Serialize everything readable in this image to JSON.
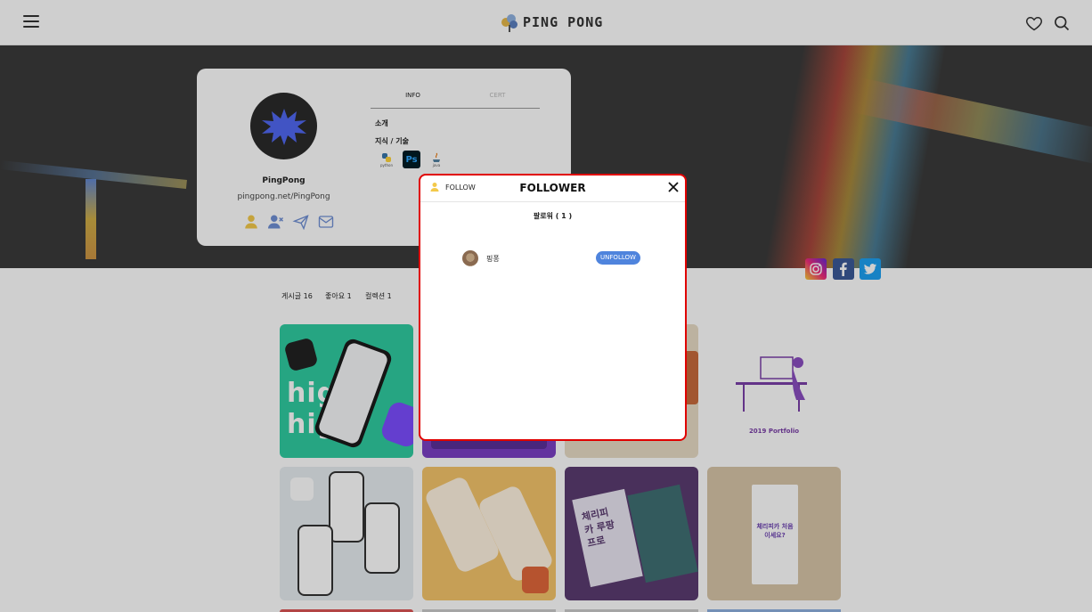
{
  "header": {
    "logo_text": "PING PONG"
  },
  "profile": {
    "name": "PingPong",
    "url": "pingpong.net/PingPong",
    "tabs": [
      {
        "label": "INFO"
      },
      {
        "label": "CERT"
      }
    ],
    "intro_label": "소개",
    "skills_label": "지식 / 기술",
    "skills": [
      {
        "name": "python",
        "label": "python"
      },
      {
        "name": "photoshop",
        "label": "Ps"
      },
      {
        "name": "java",
        "label": "java"
      }
    ]
  },
  "counts": {
    "posts": "게시글 16",
    "likes": "좋아요 1",
    "collections": "컬렉션 1"
  },
  "tiles": [
    {
      "text": "high high",
      "color": "#2fcca0"
    },
    {
      "text": "",
      "color": "#7b3fc4"
    },
    {
      "text": "",
      "color": "#e8dcc6"
    },
    {
      "text": "2019 Portfolio",
      "color": "#ffffff"
    },
    {
      "text": "",
      "color": "#e7edf0"
    },
    {
      "text": "",
      "color": "#f4c46a"
    },
    {
      "text": "체리피카 루팡프로",
      "color": "#5b3c70"
    },
    {
      "text": "체리피카 처음 이세요?",
      "color": "#d8c5a8"
    }
  ],
  "modal": {
    "follow_label": "FOLLOW",
    "title": "FOLLOWER",
    "count_label": "팔로워 ( 1 )",
    "followers": [
      {
        "name": "핑퐁",
        "action": "UNFOLLOW"
      }
    ]
  },
  "colors": {
    "accent_blue": "#4f84dd",
    "modal_border": "#e00000",
    "icon_yellow": "#f3c94a",
    "icon_blue": "#6f8fd4"
  }
}
